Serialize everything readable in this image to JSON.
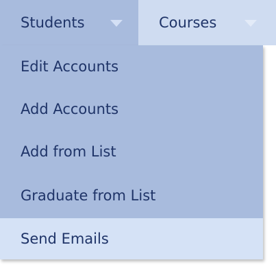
{
  "menubar": {
    "tabs": [
      {
        "label": "Students",
        "icon": "chevron-down-icon"
      },
      {
        "label": "Courses",
        "icon": "chevron-down-icon"
      }
    ]
  },
  "dropdown": {
    "items": [
      {
        "label": "Edit Accounts"
      },
      {
        "label": "Add Accounts"
      },
      {
        "label": "Add from List"
      },
      {
        "label": "Graduate from List"
      },
      {
        "label": "Send Emails",
        "state": "hovered"
      }
    ]
  },
  "colors": {
    "menu_bg": "#a8bbdd",
    "tab_inactive_bg": "#cfdcf1",
    "hover_bg": "#d5e2f6",
    "text": "#1f3468"
  }
}
